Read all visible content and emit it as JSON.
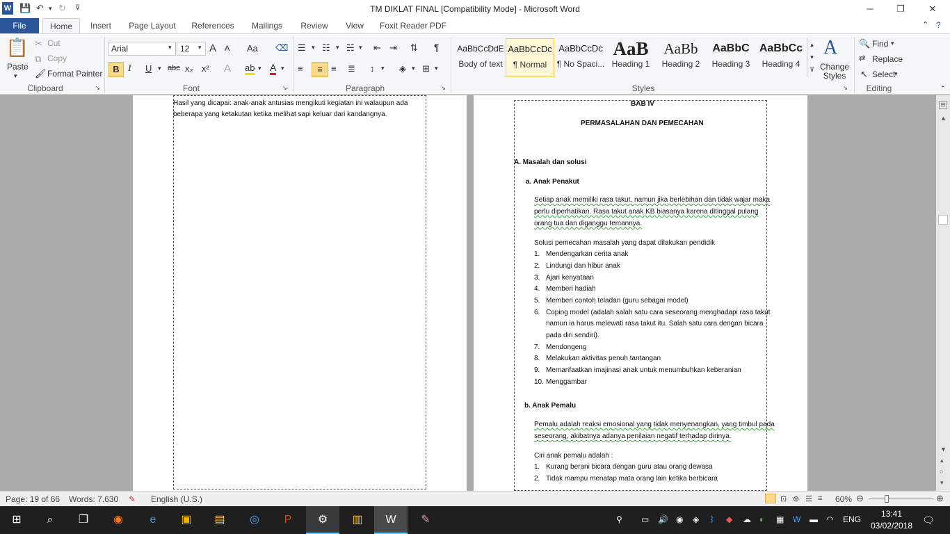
{
  "window": {
    "title": "TM DIKLAT FINAL [Compatibility Mode]  -  Microsoft Word",
    "minimize": "─",
    "restore": "❐",
    "close": "✕"
  },
  "tabs": [
    "File",
    "Home",
    "Insert",
    "Page Layout",
    "References",
    "Mailings",
    "Review",
    "View",
    "Foxit Reader PDF"
  ],
  "ribbon": {
    "clipboard": {
      "paste": "Paste",
      "cut": "Cut",
      "copy": "Copy",
      "format_painter": "Format Painter",
      "label": "Clipboard"
    },
    "font": {
      "name": "Arial",
      "size": "12",
      "label": "Font",
      "bold": "B",
      "italic": "I",
      "underline": "U",
      "strike": "abc",
      "sub": "x₂",
      "sup": "x²",
      "grow": "A",
      "shrink": "A",
      "case": "Aa"
    },
    "paragraph": {
      "label": "Paragraph",
      "pilcrow": "¶"
    },
    "styles": {
      "label": "Styles",
      "items": [
        {
          "preview": "AaBbCcDdE",
          "name": "Body of text"
        },
        {
          "preview": "AaBbCcDc",
          "name": "¶ Normal"
        },
        {
          "preview": "AaBbCcDc",
          "name": "¶ No Spaci..."
        },
        {
          "preview": "AaB",
          "name": "Heading 1"
        },
        {
          "preview": "AaBb",
          "name": "Heading 2"
        },
        {
          "preview": "AaBbC",
          "name": "Heading 3"
        },
        {
          "preview": "AaBbCc",
          "name": "Heading 4"
        }
      ],
      "change_styles": "Change Styles"
    },
    "editing": {
      "label": "Editing",
      "find": "Find",
      "replace": "Replace",
      "select": "Select"
    }
  },
  "doc": {
    "left_page": {
      "line1": "Hasil yang dicapai: anak-anak antusias mengikuti kegiatan ini walaupun ada",
      "line2": "beberapa yang ketakutan ketika melihat sapi keluar dari kandangnya."
    },
    "right_page": {
      "chapter": "BAB IV",
      "chapter_title": "PERMASALAHAN DAN PEMECAHAN",
      "section": "A.  Masalah dan solusi",
      "sub_a": "a.  Anak Penakut",
      "para_a": [
        "Setiap anak memiliki rasa takut, namun jika berlebihan dan tidak wajar maka",
        "perlu diperhatikan. Rasa takut anak KB biasanya karena ditinggal pulang",
        "orang tua dan diganggu temannya."
      ],
      "solusi_intro": "Solusi pemecahan masalah yang dapat dilakukan pendidik",
      "list_a": [
        {
          "n": "1.",
          "t": "Mendengarkan cerita anak"
        },
        {
          "n": "2.",
          "t": "Lindungi dan hibur anak"
        },
        {
          "n": "3.",
          "t": "Ajari kenyataan"
        },
        {
          "n": "4.",
          "t": "Memberi hadiah"
        },
        {
          "n": "5.",
          "t": "Memberi contoh teladan (guru sebagai model)"
        },
        {
          "n": "6.",
          "t": "Coping model (adalah salah satu cara seseorang menghadapi rasa takut"
        },
        {
          "n": "",
          "t": "namun ia harus melewati rasa takut itu. Salah satu cara dengan bicara"
        },
        {
          "n": "",
          "t": "pada diri sendiri)."
        },
        {
          "n": "7.",
          "t": "Mendongeng"
        },
        {
          "n": "8.",
          "t": "Melakukan aktivitas penuh tantangan"
        },
        {
          "n": "9.",
          "t": "Memanfaatkan imajinasi anak untuk menumbuhkan keberanian"
        },
        {
          "n": "10.",
          "t": "Menggambar"
        }
      ],
      "sub_b": "b.  Anak Pemalu",
      "para_b": [
        "Pemalu adalah reaksi emosional yang tidak menyenangkan, yang timbul pada",
        "seseorang, akibatnya adanya penilaian negatif terhadap dirinya."
      ],
      "ciri_intro": "Ciri anak pemalu adalah :",
      "list_b": [
        {
          "n": "1.",
          "t": "Kurang berani bicara dengan guru atau orang dewasa"
        },
        {
          "n": "2.",
          "t": "Tidak mampu menatap mata orang lain ketika berbicara"
        }
      ]
    }
  },
  "status": {
    "page": "Page: 19 of 66",
    "words": "Words: 7.630",
    "lang": "English (U.S.)",
    "zoom": "60%"
  },
  "taskbar": {
    "lang": "ENG",
    "time": "13:41",
    "date": "03/02/2018"
  }
}
